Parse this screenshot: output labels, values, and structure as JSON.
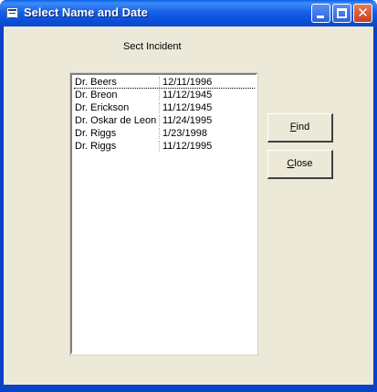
{
  "window": {
    "title": "Select Name and Date"
  },
  "form": {
    "heading": "Sect Incident"
  },
  "list": {
    "rows": [
      {
        "name": "Dr. Beers",
        "date": "12/11/1996"
      },
      {
        "name": "Dr. Breon",
        "date": "11/12/1945"
      },
      {
        "name": "Dr. Erickson",
        "date": "11/12/1945"
      },
      {
        "name": "Dr. Oskar de Leon",
        "date": "11/24/1995"
      },
      {
        "name": "Dr. Riggs",
        "date": "1/23/1998"
      },
      {
        "name": "Dr. Riggs",
        "date": "11/12/1995"
      }
    ]
  },
  "buttons": {
    "find_mnemonic": "F",
    "find_rest": "ind",
    "close_mnemonic": "C",
    "close_rest": "lose"
  },
  "caption_buttons": {
    "minimize_icon": "minimize-icon",
    "maximize_icon": "maximize-icon",
    "close_icon": "close-icon",
    "close_glyph": "✕"
  },
  "colors": {
    "titlebar": "#0a4fd8",
    "client_bg": "#ece9d8",
    "close_button": "#c7401c"
  }
}
